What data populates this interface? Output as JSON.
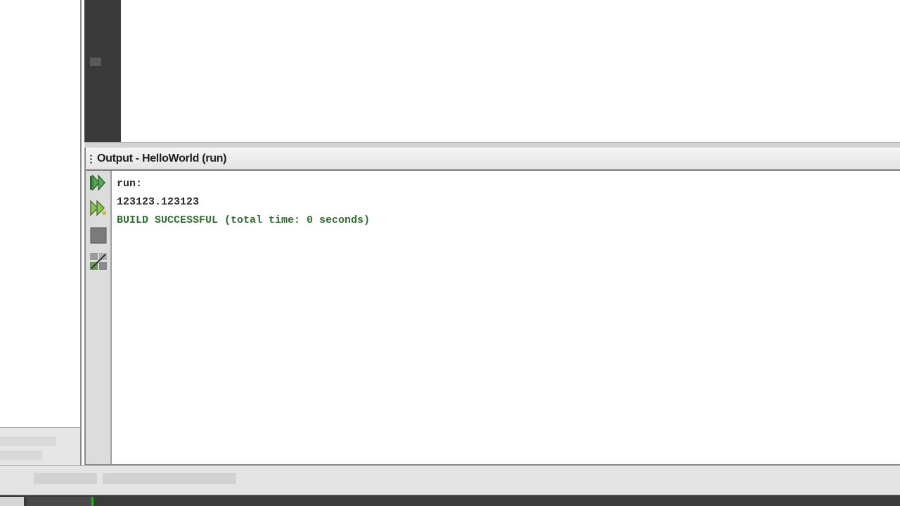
{
  "output_window": {
    "title": "Output - HelloWorld (run)",
    "lines": {
      "run": "run:",
      "value": "123123.123123",
      "build": "BUILD SUCCESSFUL (total time: 0 seconds)"
    },
    "toolbar": [
      {
        "icon": "rerun-icon"
      },
      {
        "icon": "rerun-with-options-icon"
      },
      {
        "icon": "stop-icon"
      },
      {
        "icon": "settings-icon"
      }
    ]
  },
  "colors": {
    "success_text": "#2f6f2f",
    "editor_gutter": "#3a3a3a",
    "taskbar_accent": "#27b027"
  }
}
